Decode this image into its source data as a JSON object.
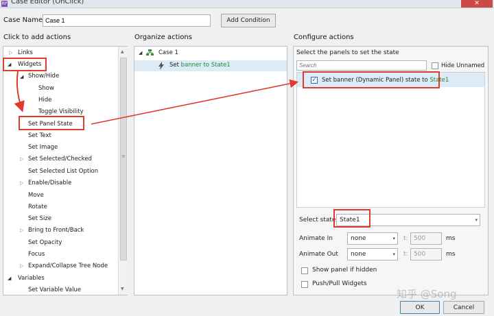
{
  "window": {
    "title": "Case Editor (OnClick)",
    "app_icon": "RP",
    "close_glyph": "✕"
  },
  "case_name": {
    "label": "Case Name",
    "value": "Case 1",
    "add_condition": "Add Condition"
  },
  "actions_panel": {
    "heading": "Click to add actions",
    "items": [
      {
        "label": "Links",
        "tri": "▷"
      },
      {
        "label": "Widgets",
        "tri": "◢"
      },
      {
        "label": "Show/Hide",
        "tri": "◢"
      },
      {
        "label": "Show"
      },
      {
        "label": "Hide"
      },
      {
        "label": "Toggle Visibility"
      },
      {
        "label": "Set Panel State"
      },
      {
        "label": "Set Text"
      },
      {
        "label": "Set Image"
      },
      {
        "label": "Set Selected/Checked",
        "tri": "▷"
      },
      {
        "label": "Set Selected List Option"
      },
      {
        "label": "Enable/Disable",
        "tri": "▷"
      },
      {
        "label": "Move"
      },
      {
        "label": "Rotate"
      },
      {
        "label": "Set Size"
      },
      {
        "label": "Bring to Front/Back",
        "tri": "▷"
      },
      {
        "label": "Set Opacity"
      },
      {
        "label": "Focus"
      },
      {
        "label": "Expand/Collapse Tree Node",
        "tri": "▷"
      },
      {
        "label": "Variables",
        "tri": "◢"
      },
      {
        "label": "Set Variable Value"
      }
    ]
  },
  "organize_panel": {
    "heading": "Organize actions",
    "case_label": "Case 1",
    "case_tri": "◢",
    "action_prefix": "Set ",
    "action_target": "banner to State1"
  },
  "configure_panel": {
    "heading": "Configure actions",
    "subheading": "Select the panels to set the state",
    "search_placeholder": "Search",
    "hide_unnamed": "Hide Unnamed",
    "panel_item_prefix": "Set banner (Dynamic Panel) state to ",
    "panel_item_state": "State1",
    "select_state_label": "Select state",
    "select_state_value": "State1",
    "animate_in_label": "Animate In",
    "animate_in_value": "none",
    "animate_out_label": "Animate Out",
    "animate_out_value": "none",
    "t_label": "t:",
    "duration_in": "500",
    "duration_out": "500",
    "ms": "ms",
    "show_if_hidden": "Show panel if hidden",
    "push_pull": "Push/Pull Widgets"
  },
  "footer": {
    "ok": "OK",
    "cancel": "Cancel"
  },
  "watermark": "知乎 @Song",
  "colors": {
    "annotation_red": "#e03a2c",
    "state_green": "#1f8a2b",
    "selection_blue": "#dcebf8"
  }
}
